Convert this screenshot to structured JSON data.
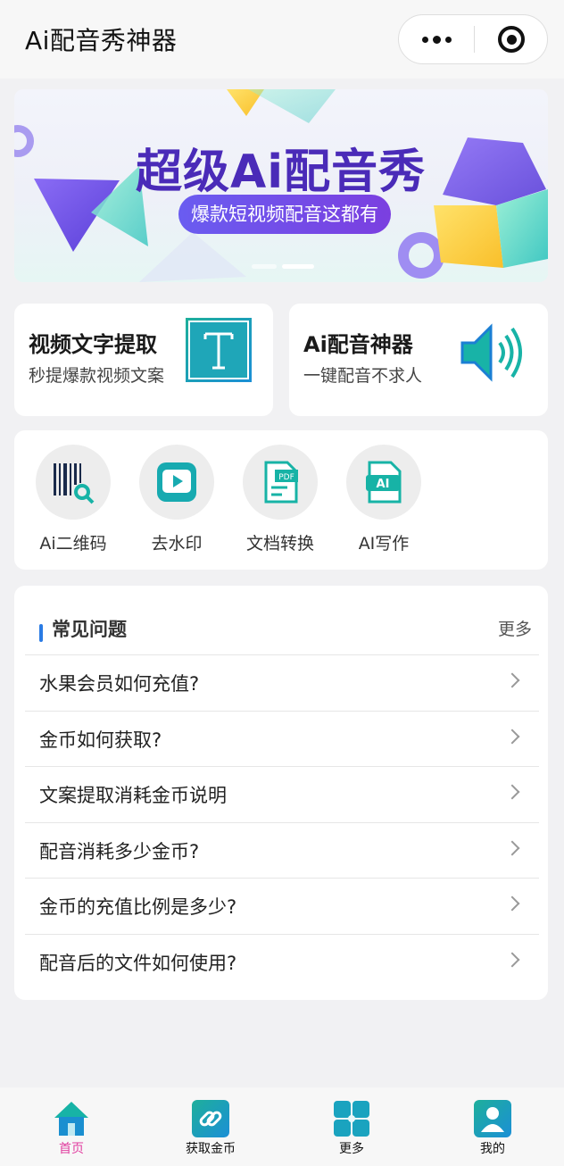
{
  "window": {
    "title": "Ai配音秀神器"
  },
  "capsule": {
    "more_icon": "more-dots-icon",
    "close_icon": "target-circle-icon"
  },
  "banner": {
    "title": "超级Ai配音秀",
    "subtitle": "爆款短视频配音这都有",
    "slide_count": 2,
    "active_slide": 2
  },
  "features": [
    {
      "title": "视频文字提取",
      "subtitle": "秒提爆款视频文案",
      "icon": "text-t-icon"
    },
    {
      "title": "Ai配音神器",
      "subtitle": "一键配音不求人",
      "icon": "speaker-icon"
    }
  ],
  "tools": [
    {
      "label": "Ai二维码",
      "icon": "barcode-search-icon"
    },
    {
      "label": "去水印",
      "icon": "video-play-icon"
    },
    {
      "label": "文档转换",
      "icon": "pdf-document-icon"
    },
    {
      "label": "AI写作",
      "icon": "ai-document-icon"
    }
  ],
  "faq": {
    "title": "常见问题",
    "more": "更多",
    "items": [
      "水果会员如何充值?",
      "金币如何获取?",
      "文案提取消耗金币说明",
      "配音消耗多少金币?",
      "金币的充值比例是多少?",
      "配音后的文件如何使用?"
    ]
  },
  "tabbar": [
    {
      "label": "首页",
      "icon": "home-icon",
      "active": true
    },
    {
      "label": "获取金币",
      "icon": "link-icon",
      "active": false
    },
    {
      "label": "更多",
      "icon": "grid-icon",
      "active": false
    },
    {
      "label": "我的",
      "icon": "user-icon",
      "active": false
    }
  ],
  "colors": {
    "accent": "#2a7be4",
    "active_tab": "#e13ea0",
    "teal": "#17b3a6"
  }
}
